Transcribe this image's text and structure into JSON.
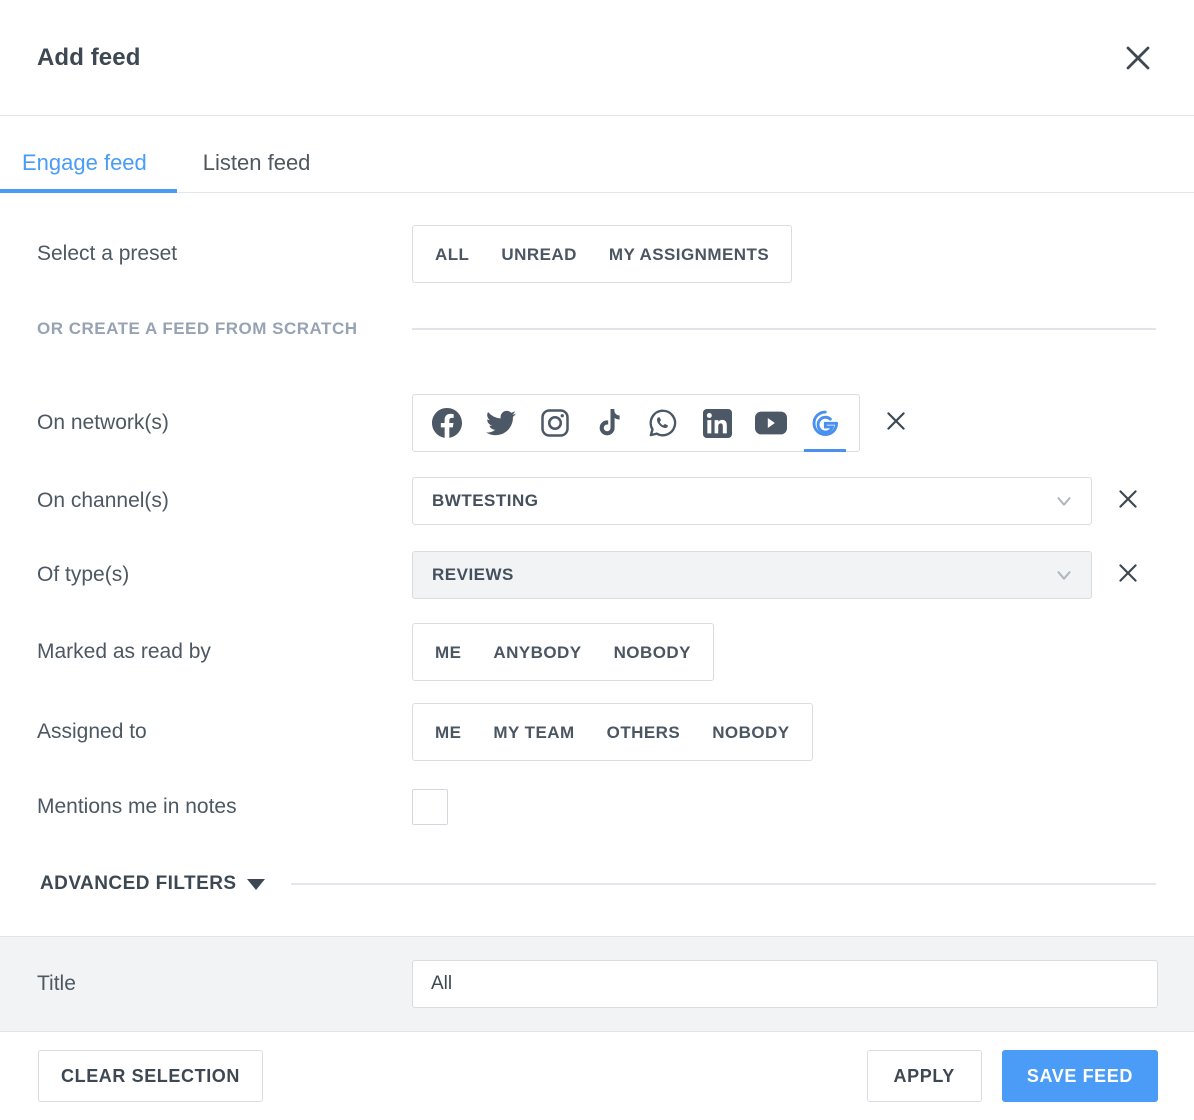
{
  "dialog": {
    "title": "Add feed",
    "close_icon": "close-icon"
  },
  "tabs": [
    {
      "label": "Engage feed",
      "active": true
    },
    {
      "label": "Listen feed",
      "active": false
    }
  ],
  "form": {
    "preset": {
      "label": "Select a preset",
      "options": [
        "ALL",
        "UNREAD",
        "MY ASSIGNMENTS"
      ]
    },
    "scratch_heading": "OR CREATE A FEED FROM SCRATCH",
    "networks": {
      "label": "On network(s)",
      "items": [
        {
          "name": "facebook-icon",
          "selected": false
        },
        {
          "name": "twitter-icon",
          "selected": false
        },
        {
          "name": "instagram-icon",
          "selected": false
        },
        {
          "name": "tiktok-icon",
          "selected": false
        },
        {
          "name": "whatsapp-icon",
          "selected": false
        },
        {
          "name": "linkedin-icon",
          "selected": false
        },
        {
          "name": "youtube-icon",
          "selected": false
        },
        {
          "name": "google-icon",
          "selected": true
        }
      ],
      "clear_icon": "close-icon"
    },
    "channels": {
      "label": "On channel(s)",
      "value": "BWTESTING",
      "chevron_icon": "chevron-down-icon",
      "clear_icon": "close-icon"
    },
    "types": {
      "label": "Of type(s)",
      "value": "REVIEWS",
      "chevron_icon": "chevron-down-icon",
      "clear_icon": "close-icon"
    },
    "marked_as_read_by": {
      "label": "Marked as read by",
      "options": [
        "ME",
        "ANYBODY",
        "NOBODY"
      ]
    },
    "assigned_to": {
      "label": "Assigned to",
      "options": [
        "ME",
        "MY TEAM",
        "OTHERS",
        "NOBODY"
      ]
    },
    "mentions": {
      "label": "Mentions me in notes",
      "checked": false
    },
    "advanced_filters": {
      "label": "ADVANCED FILTERS",
      "caret_icon": "caret-down-icon"
    },
    "title_field": {
      "label": "Title",
      "value": "All",
      "placeholder": "Title"
    }
  },
  "footer": {
    "clear_selection": "CLEAR SELECTION",
    "apply": "APPLY",
    "save_feed": "SAVE FEED"
  },
  "colors": {
    "accent": "#4a9cf6",
    "google_blue": "#4a90ee",
    "text": "#44525f",
    "muted": "#97a3b3",
    "border": "#d9dde2",
    "strip_bg": "#f1f3f5"
  }
}
